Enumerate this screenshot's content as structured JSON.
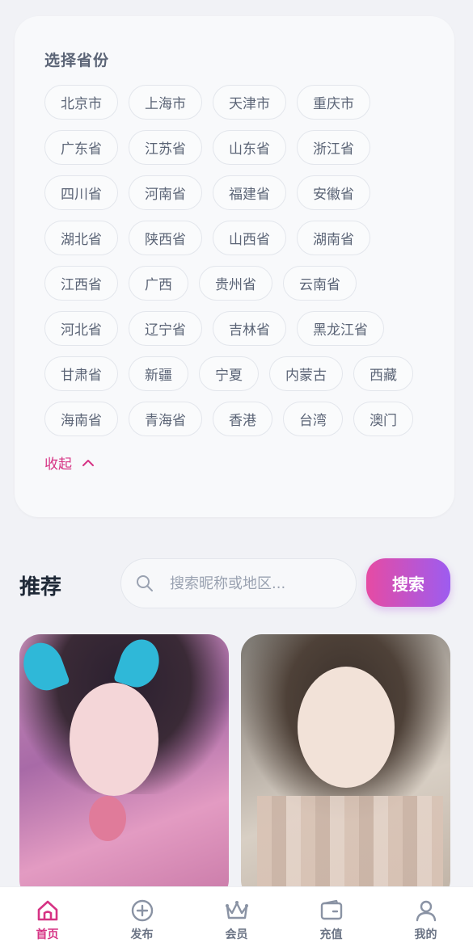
{
  "province_panel": {
    "title": "选择省份",
    "rows": [
      [
        "北京市",
        "上海市",
        "天津市",
        "重庆市"
      ],
      [
        "广东省",
        "江苏省",
        "山东省",
        "浙江省"
      ],
      [
        "四川省",
        "河南省",
        "福建省",
        "安徽省"
      ],
      [
        "湖北省",
        "陕西省",
        "山西省",
        "湖南省"
      ],
      [
        "江西省",
        "广西",
        "贵州省",
        "云南省"
      ],
      [
        "河北省",
        "辽宁省",
        "吉林省",
        "黑龙江省"
      ],
      [
        "甘肃省",
        "新疆",
        "宁夏",
        "内蒙古",
        "西藏"
      ],
      [
        "海南省",
        "青海省",
        "香港",
        "台湾",
        "澳门"
      ]
    ],
    "collapse_label": "收起"
  },
  "recommend": {
    "title": "推荐",
    "search_placeholder": "搜索昵称或地区...",
    "search_button": "搜索"
  },
  "bottom_nav": [
    {
      "label": "首页",
      "icon": "home-icon",
      "active": true
    },
    {
      "label": "发布",
      "icon": "plus-circle-icon",
      "active": false
    },
    {
      "label": "会员",
      "icon": "crown-icon",
      "active": false
    },
    {
      "label": "充值",
      "icon": "wallet-icon",
      "active": false
    },
    {
      "label": "我的",
      "icon": "user-icon",
      "active": false
    }
  ],
  "colors": {
    "accent": "#d63384",
    "button_gradient_start": "#e64ba3",
    "button_gradient_end": "#9d5cf0"
  }
}
